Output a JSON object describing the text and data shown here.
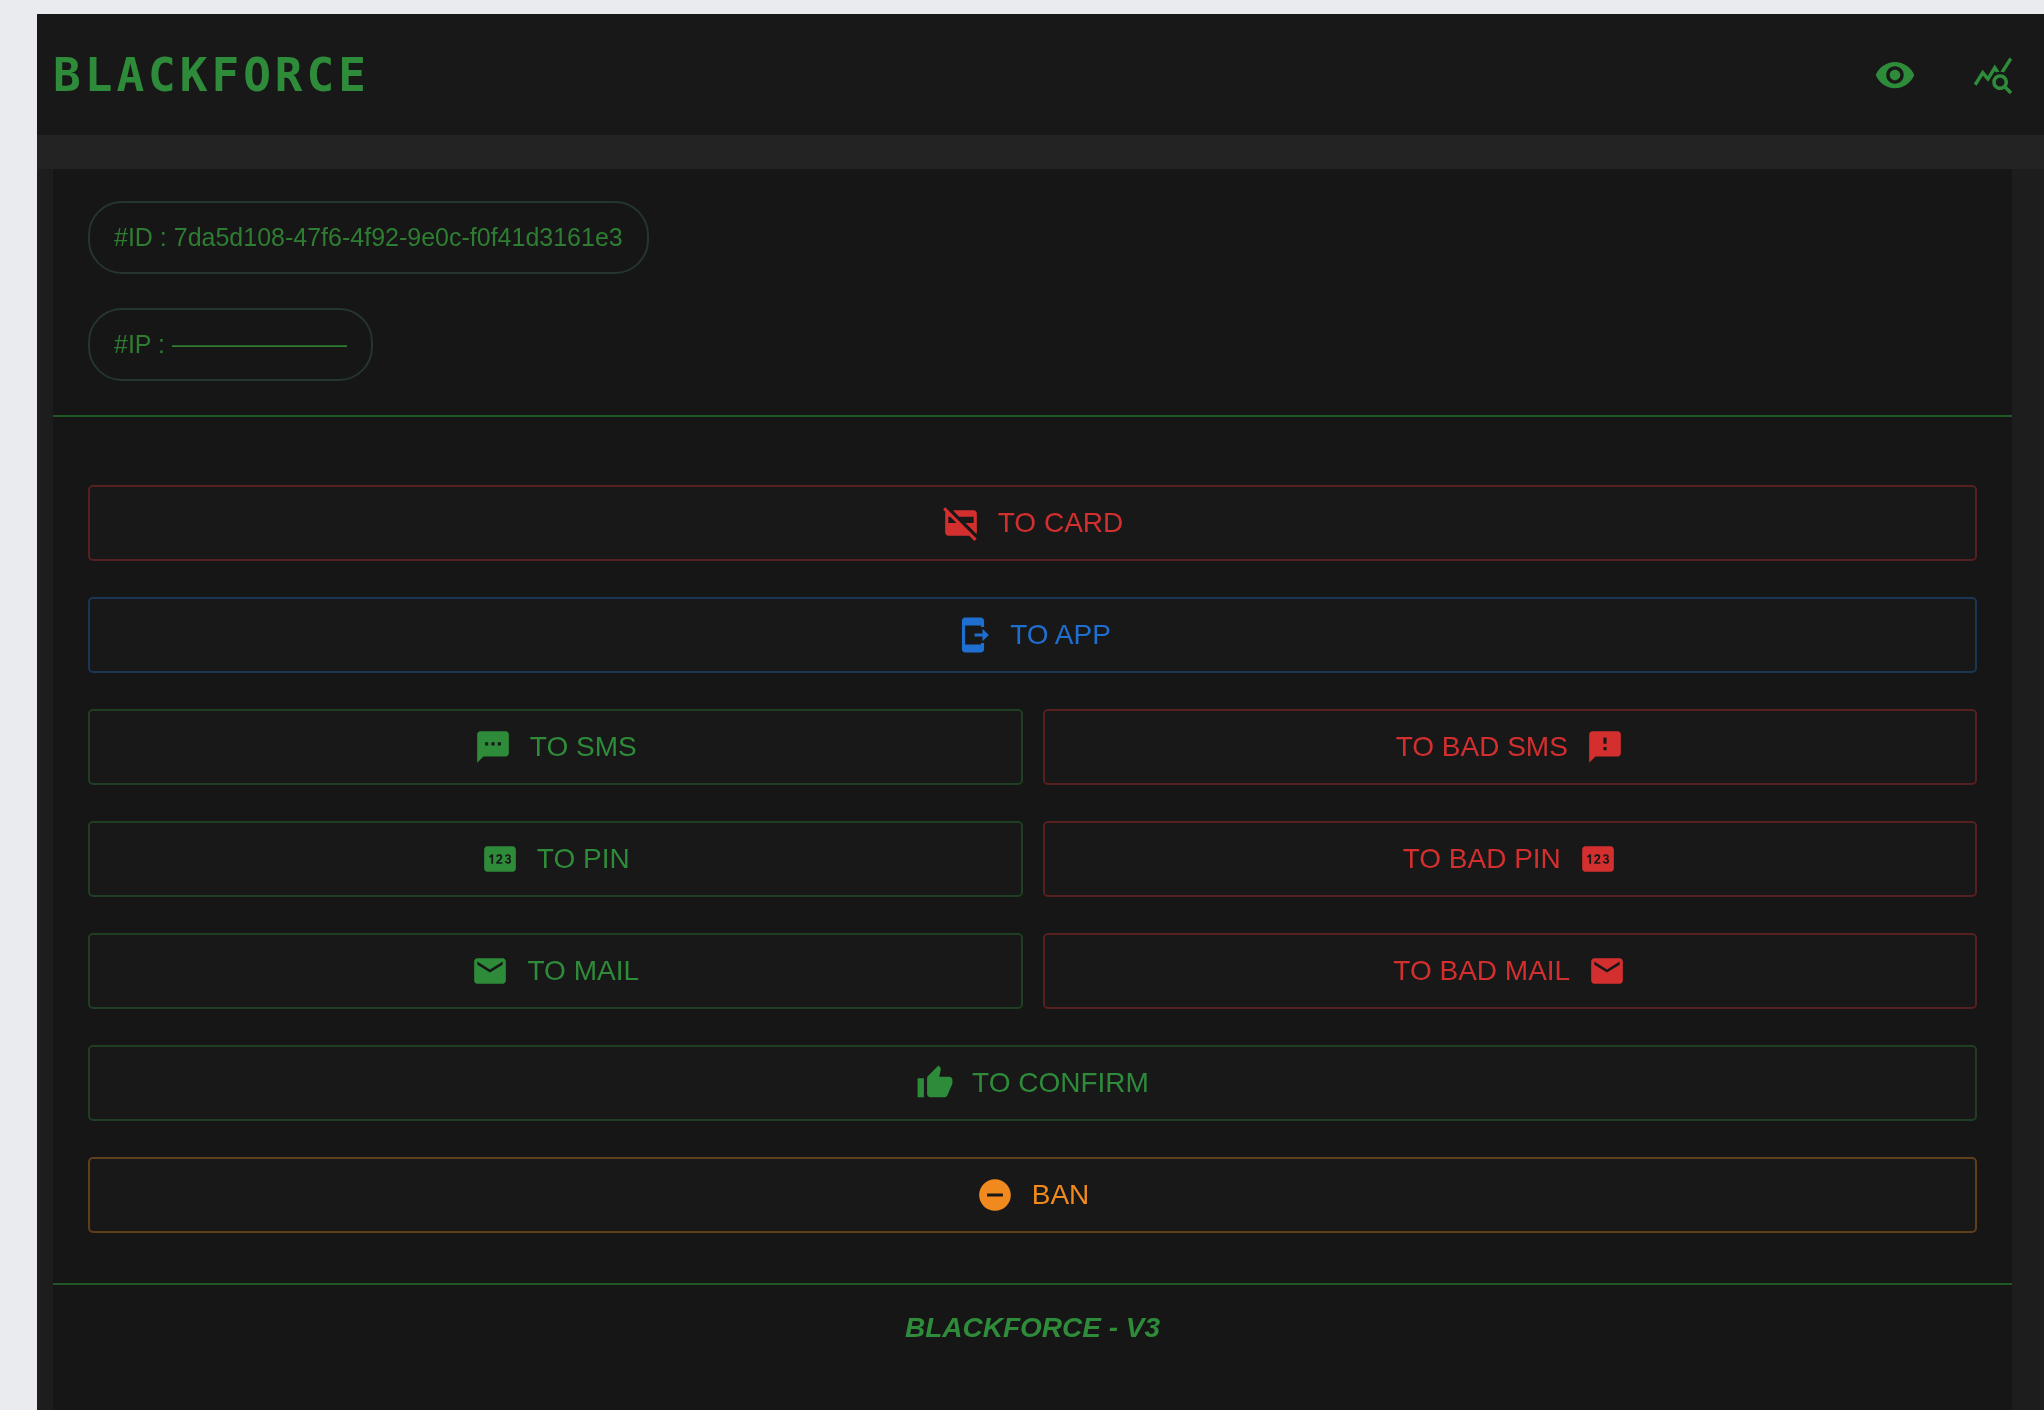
{
  "header": {
    "logo": "BLACKFORCE"
  },
  "info": [
    {
      "label": "#ID : 7da5d108-47f6-4f92-9e0c-f0f41d3161e3"
    },
    {
      "label": "#IP : ———————"
    }
  ],
  "action_rows": [
    [
      {
        "label": "TO CARD",
        "kind": "card",
        "color": "#d32f2f",
        "icon_after": false
      }
    ],
    [
      {
        "label": "TO APP",
        "kind": "app",
        "color": "#1e6fd0",
        "icon_after": false
      }
    ],
    [
      {
        "label": "TO SMS",
        "kind": "sms",
        "color": "#2e8b3a",
        "icon_after": false
      },
      {
        "label": "TO BAD SMS",
        "kind": "badsms",
        "color": "#d32f2f",
        "icon_after": true
      }
    ],
    [
      {
        "label": "TO PIN",
        "kind": "pin",
        "color": "#2e8b3a",
        "icon_after": false
      },
      {
        "label": "TO BAD PIN",
        "kind": "pin",
        "color": "#d32f2f",
        "icon_after": true
      }
    ],
    [
      {
        "label": "TO MAIL",
        "kind": "mail",
        "color": "#2e8b3a",
        "icon_after": false
      },
      {
        "label": "TO BAD MAIL",
        "kind": "mail",
        "color": "#d32f2f",
        "icon_after": true
      }
    ],
    [
      {
        "label": "TO CONFIRM",
        "kind": "confirm",
        "color": "#2e8b3a",
        "icon_after": false
      }
    ],
    [
      {
        "label": "BAN",
        "kind": "ban",
        "color": "#f08a1e",
        "icon_after": false
      }
    ]
  ],
  "footer": {
    "text": "BLACKFORCE - V3"
  }
}
